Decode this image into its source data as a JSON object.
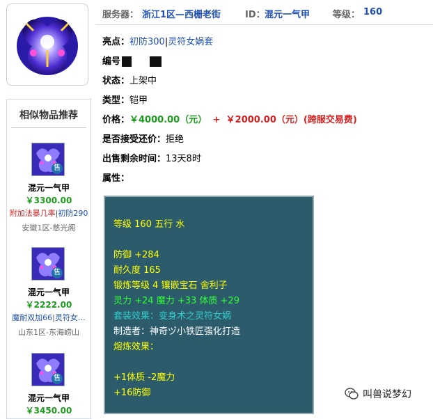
{
  "header": {
    "server_label": "服务器：",
    "server_value": "浙江1区—西栅老街",
    "id_label": "ID：",
    "id_value": "混元一气甲",
    "level_label": "等级：",
    "level_value": "160"
  },
  "info": {
    "highlight_label": "亮点：",
    "highlight_a": "初防300",
    "highlight_sep": "|",
    "highlight_b": "灵符女娲套",
    "number_label": "编号",
    "status_label": "状态：",
    "status_value": "上架中",
    "type_label": "类型：",
    "type_value": "铠甲",
    "price_label": "价格：",
    "price_value": "￥4000.00（元）",
    "price_plus": "+",
    "price_cross": "￥2000.00（元）(跨服交易费)",
    "counter_label": "是否接受还价：",
    "counter_value": "拒绝",
    "remain_label": "出售剩余时间：",
    "remain_value": "13天8时",
    "attr_label": "属性："
  },
  "attributes": {
    "line1": "等级 160 五行 水",
    "line2": "防御 +284",
    "line3": "耐久度 165",
    "line4": "锻炼等级 4 镶嵌宝石 舍利子",
    "line5": "灵力 +24 魔力 +33 体质 +29",
    "line6": "套装效果：变身术之灵符女娲",
    "line7": "制造者：神奇ヅ小铁匠强化打造",
    "line8": "熔炼效果：",
    "line9": "+1体质 -2魔力",
    "line10": "+16防御"
  },
  "similar": {
    "title": "相似物品推荐",
    "sell_tag": "售",
    "items": [
      {
        "name": "混元一气甲",
        "price": "￥3300.00",
        "tag_a": "附加法暴几率",
        "tag_sep": "|",
        "tag_b": "初防290",
        "server": "安徽1区-慈光阁"
      },
      {
        "name": "混元一气甲",
        "price": "￥2222.00",
        "tag_a": "魔耐双加66",
        "tag_sep": "|",
        "tag_b": "灵符女…",
        "server": "山东1区-东海崂山"
      },
      {
        "name": "混元一气甲",
        "price": "￥3450.00"
      }
    ]
  },
  "watermark": {
    "text": "叫兽说梦幻",
    "icon": "wechat-icon"
  },
  "colors": {
    "accent_blue": "#1f4fb0",
    "price_green": "#1b9b1b",
    "red": "#d42020",
    "attr_bg": "#2c5c6c"
  }
}
